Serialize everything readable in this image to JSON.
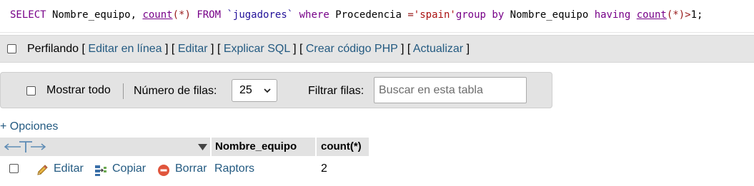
{
  "sql": {
    "tokens": [
      {
        "t": "SELECT",
        "c": "kw"
      },
      {
        "t": " Nombre_equipo, ",
        "c": "pl"
      },
      {
        "t": "count",
        "c": "fn"
      },
      {
        "t": "(*)",
        "c": "op"
      },
      {
        "t": " FROM ",
        "c": "kw"
      },
      {
        "t": "`jugadores`",
        "c": "bt"
      },
      {
        "t": " where ",
        "c": "kw"
      },
      {
        "t": "Procedencia ",
        "c": "pl"
      },
      {
        "t": "=",
        "c": "op"
      },
      {
        "t": "'spain'",
        "c": "str"
      },
      {
        "t": "group by",
        "c": "kw"
      },
      {
        "t": " Nombre_equipo ",
        "c": "pl"
      },
      {
        "t": "having",
        "c": "kw"
      },
      {
        "t": " ",
        "c": "pl"
      },
      {
        "t": "count",
        "c": "fn"
      },
      {
        "t": "(*)>",
        "c": "op"
      },
      {
        "t": "1",
        "c": "pl"
      },
      {
        "t": ";",
        "c": "pl"
      }
    ]
  },
  "profiling": {
    "label": "Perfilando",
    "links": [
      "Editar en línea",
      "Editar",
      "Explicar SQL",
      "Crear código PHP",
      "Actualizar"
    ]
  },
  "nav": {
    "show_all": "Mostrar todo",
    "rows_label": "Número de filas:",
    "rows_value": "25",
    "filter_label": "Filtrar filas:",
    "search_placeholder": "Buscar en esta tabla"
  },
  "options_link": "+ Opciones",
  "table": {
    "columns": [
      "Nombre_equipo",
      "count(*)"
    ],
    "actions": {
      "edit": "Editar",
      "copy": "Copiar",
      "delete": "Borrar"
    },
    "rows": [
      {
        "Nombre_equipo": "Raptors",
        "count": "2"
      }
    ]
  },
  "colors": {
    "link": "#235a81",
    "keyword": "#770088",
    "string": "#aa1111",
    "header_bg": "#e2e2e2",
    "bar_bg": "#e5e5e5"
  }
}
